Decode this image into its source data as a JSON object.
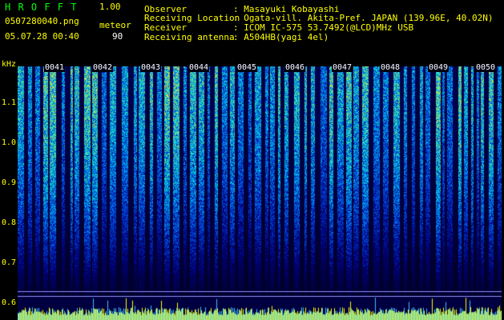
{
  "app": {
    "title": "H R O F F T",
    "version": "1.00",
    "filename": "0507280040.png",
    "datetime": "05.07.28 00:40",
    "count_label": "meteor",
    "count_value": "90"
  },
  "info": {
    "labels": [
      "Observer",
      "Receiving Location",
      "Receiver",
      "Receiving antenna"
    ],
    "values": [
      ": Masayuki Kobayashi",
      ": Ogata-vill. Akita-Pref. JAPAN (139.96E, 40.02N)",
      ": ICOM IC-575 53.7492(@LCD)MHz USB",
      ": A504HB(yagi 4el)"
    ]
  },
  "yaxis": {
    "unit": "kHz",
    "ticks": [
      {
        "label": "1.1",
        "value": 1.1
      },
      {
        "label": "1.0",
        "value": 1.0
      },
      {
        "label": "0.9",
        "value": 0.9
      },
      {
        "label": "0.8",
        "value": 0.8
      },
      {
        "label": "0.7",
        "value": 0.7
      },
      {
        "label": "0.6",
        "value": 0.6
      }
    ]
  },
  "time_markers": [
    "0041",
    "0042",
    "0043",
    "0044",
    "0045",
    "0046",
    "0047",
    "0048",
    "0049",
    "0050"
  ],
  "colors": {
    "text_yellow": "#ffff00",
    "text_white": "#ffffff",
    "title_green": "#00ff00",
    "background": "#000000",
    "spectrum_low": "#00003a",
    "spectrum_high": "#40ffd0"
  }
}
